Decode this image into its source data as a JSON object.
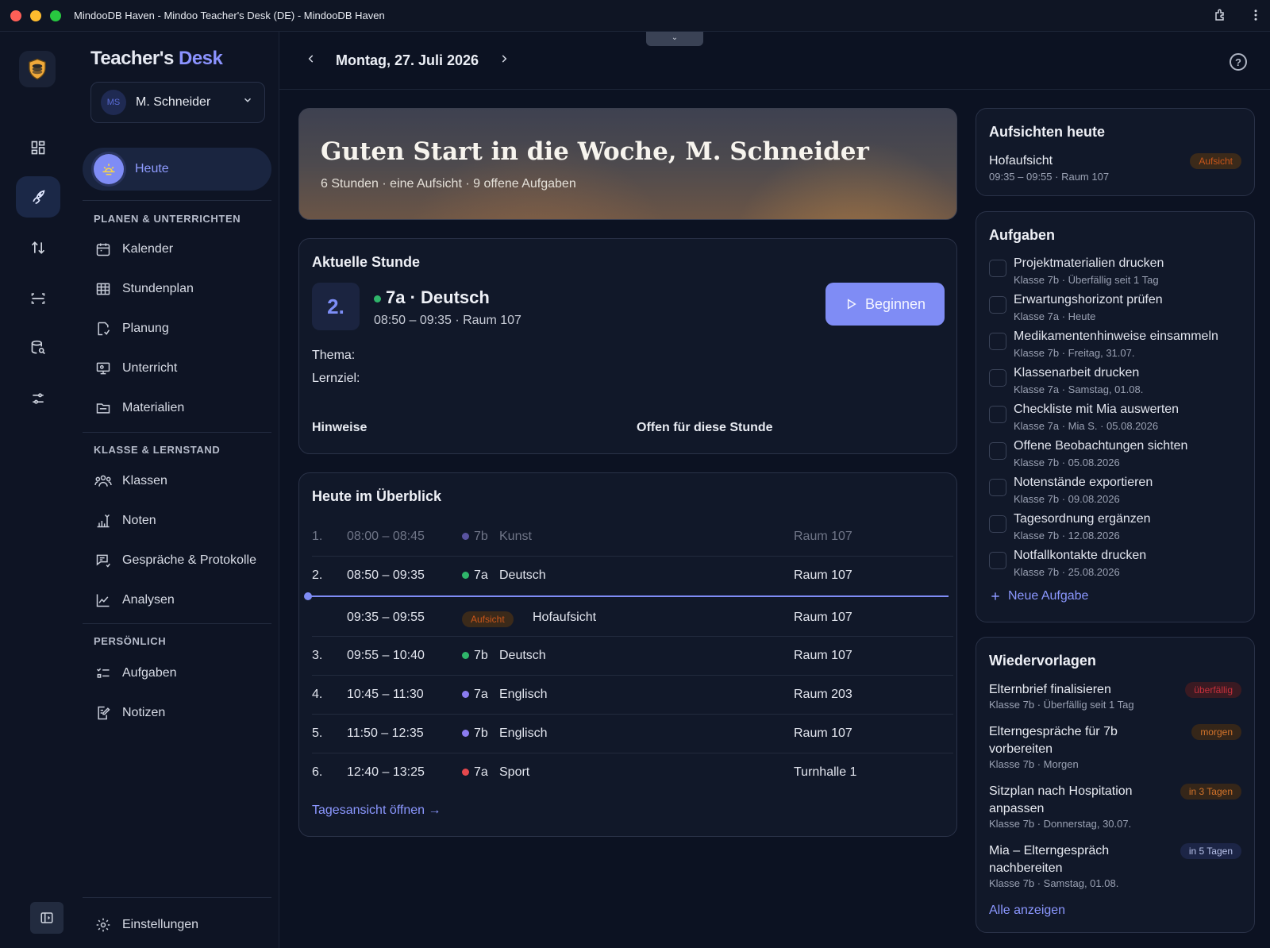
{
  "window": {
    "title": "MindooDB Haven - Mindoo Teacher's Desk (DE) - MindooDB Haven"
  },
  "brand": {
    "part1": "Teacher's",
    "part2": "Desk"
  },
  "user": {
    "initials": "MS",
    "name": "M. Schneider"
  },
  "nav": {
    "today": "Heute",
    "section1": "PLANEN & UNTERRICHTEN",
    "items1": [
      "Kalender",
      "Stundenplan",
      "Planung",
      "Unterricht",
      "Materialien"
    ],
    "section2": "KLASSE & LERNSTAND",
    "items2": [
      "Klassen",
      "Noten",
      "Gespräche & Protokolle",
      "Analysen"
    ],
    "section3": "PERSÖNLICH",
    "items3": [
      "Aufgaben",
      "Notizen"
    ],
    "settings": "Einstellungen"
  },
  "header": {
    "date": "Montag, 27. Juli 2026",
    "help": "?"
  },
  "hero": {
    "title": "Guten Start in die Woche, M. Schneider",
    "subtitle": "6 Stunden · eine Aufsicht · 9 offene Aufgaben"
  },
  "current": {
    "title": "Aktuelle Stunde",
    "period": "2.",
    "class_subject": "7a · Deutsch",
    "time_room": "08:50 – 09:35 · Raum 107",
    "topic_label": "Thema:",
    "goal_label": "Lernziel:",
    "notes_label": "Hinweise",
    "open_label": "Offen für diese Stunde",
    "begin": "Beginnen"
  },
  "overview": {
    "title": "Heute im Überblick",
    "rows": [
      {
        "num": "1.",
        "time": "08:00 – 08:45",
        "cls": "7b",
        "subject": "Kunst",
        "room": "Raum 107",
        "color": "#8b7cf0"
      },
      {
        "num": "2.",
        "time": "08:50 – 09:35",
        "cls": "7a",
        "subject": "Deutsch",
        "room": "Raum 107",
        "color": "#2fb56a"
      },
      {
        "num": "",
        "time": "09:35 – 09:55",
        "badge": "Aufsicht",
        "subject": "Hofaufsicht",
        "room": "Raum 107"
      },
      {
        "num": "3.",
        "time": "09:55 – 10:40",
        "cls": "7b",
        "subject": "Deutsch",
        "room": "Raum 107",
        "color": "#2fb56a"
      },
      {
        "num": "4.",
        "time": "10:45 – 11:30",
        "cls": "7a",
        "subject": "Englisch",
        "room": "Raum 203",
        "color": "#8b7cf0"
      },
      {
        "num": "5.",
        "time": "11:50 – 12:35",
        "cls": "7b",
        "subject": "Englisch",
        "room": "Raum 107",
        "color": "#8b7cf0"
      },
      {
        "num": "6.",
        "time": "12:40 – 13:25",
        "cls": "7a",
        "subject": "Sport",
        "room": "Turnhalle 1",
        "color": "#e5484d"
      }
    ],
    "link": "Tagesansicht öffnen →"
  },
  "supervision": {
    "title": "Aufsichten heute",
    "name": "Hofaufsicht",
    "detail": "09:35 – 09:55 · Raum 107",
    "badge": "Aufsicht"
  },
  "tasks": {
    "title": "Aufgaben",
    "items": [
      {
        "title": "Projektmaterialien drucken",
        "sub": "Klasse 7b · Überfällig seit 1 Tag"
      },
      {
        "title": "Erwartungshorizont prüfen",
        "sub": "Klasse 7a · Heute"
      },
      {
        "title": "Medikamentenhinweise einsammeln",
        "sub": "Klasse 7b · Freitag, 31.07."
      },
      {
        "title": "Klassenarbeit drucken",
        "sub": "Klasse 7a · Samstag, 01.08."
      },
      {
        "title": "Checkliste mit Mia auswerten",
        "sub": "Klasse 7a · Mia S. · 05.08.2026"
      },
      {
        "title": "Offene Beobachtungen sichten",
        "sub": "Klasse 7b · 05.08.2026"
      },
      {
        "title": "Notenstände exportieren",
        "sub": "Klasse 7b · 09.08.2026"
      },
      {
        "title": "Tagesordnung ergänzen",
        "sub": "Klasse 7b · 12.08.2026"
      },
      {
        "title": "Notfallkontakte drucken",
        "sub": "Klasse 7b · 25.08.2026"
      }
    ],
    "add": "Neue Aufgabe"
  },
  "followups": {
    "title": "Wiedervorlagen",
    "items": [
      {
        "title": "Elternbrief finalisieren",
        "sub": "Klasse 7b · Überfällig seit 1 Tag",
        "badge": "überfällig"
      },
      {
        "title": "Elterngespräche für 7b vorbereiten",
        "sub": "Klasse 7b · Morgen",
        "badge": "morgen"
      },
      {
        "title": "Sitzplan nach Hospitation anpassen",
        "sub": "Klasse 7b · Donnerstag, 30.07.",
        "badge": "in 3 Tagen"
      },
      {
        "title": "Mia – Elterngespräch nachbereiten",
        "sub": "Klasse 7b · Samstag, 01.08.",
        "badge": "in 5 Tagen"
      }
    ],
    "link": "Alle anzeigen"
  }
}
